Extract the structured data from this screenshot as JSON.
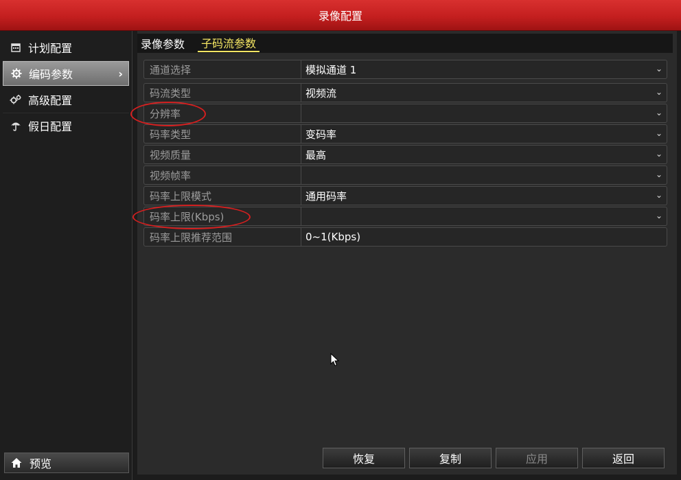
{
  "window": {
    "title": "录像配置"
  },
  "sidebar": {
    "items": [
      {
        "label": "计划配置",
        "icon": "calendar-icon"
      },
      {
        "label": "编码参数",
        "icon": "gear-icon",
        "active": true
      },
      {
        "label": "高级配置",
        "icon": "gears-icon"
      },
      {
        "label": "假日配置",
        "icon": "umbrella-icon"
      }
    ],
    "preview": {
      "label": "预览",
      "icon": "home-icon"
    }
  },
  "tabs": [
    {
      "label": "录像参数",
      "active": false
    },
    {
      "label": "子码流参数",
      "active": true
    }
  ],
  "form": {
    "rows": [
      {
        "label": "通道选择",
        "value": "模拟通道 1",
        "dropdown": true
      },
      {
        "label": "码流类型",
        "value": "视频流",
        "dropdown": true
      },
      {
        "label": "分辨率",
        "value": "",
        "dropdown": true
      },
      {
        "label": "码率类型",
        "value": "变码率",
        "dropdown": true
      },
      {
        "label": "视频质量",
        "value": "最高",
        "dropdown": true
      },
      {
        "label": "视频帧率",
        "value": "",
        "dropdown": true
      },
      {
        "label": "码率上限模式",
        "value": "通用码率",
        "dropdown": true
      },
      {
        "label": "码率上限(Kbps)",
        "value": "",
        "dropdown": true
      },
      {
        "label": "码率上限推荐范围",
        "value": "0~1(Kbps)",
        "dropdown": false
      }
    ]
  },
  "buttons": {
    "restore": "恢复",
    "copy": "复制",
    "apply": "应用",
    "back": "返回"
  },
  "colors": {
    "title_bar": "#c41f1f",
    "active_tab": "#f5e663",
    "annotation": "#d61f1f"
  }
}
